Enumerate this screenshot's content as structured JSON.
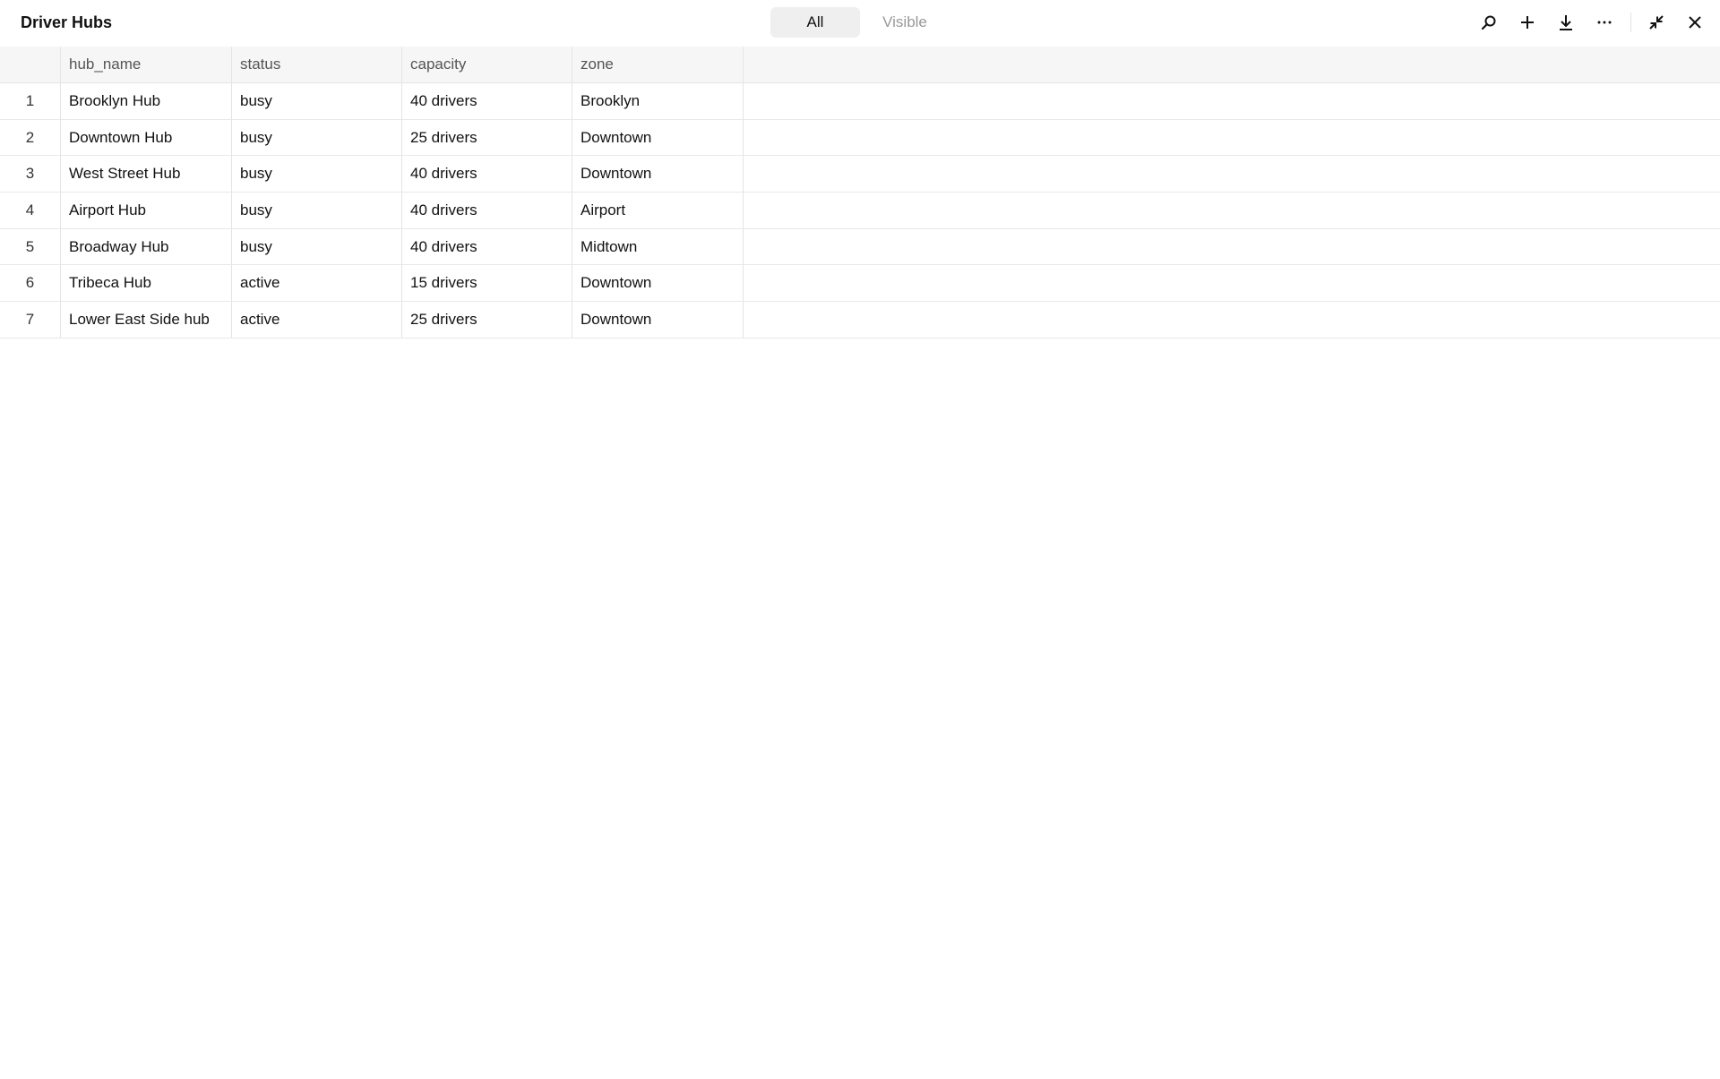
{
  "header": {
    "title": "Driver Hubs",
    "segments": {
      "all": "All",
      "visible": "Visible"
    },
    "tools": [
      "search-icon",
      "plus-icon",
      "download-icon",
      "more-icon",
      "collapse-icon",
      "close-icon"
    ]
  },
  "table": {
    "columns": [
      "hub_name",
      "status",
      "capacity",
      "zone"
    ],
    "rows": [
      {
        "index": "1",
        "hub_name": "Brooklyn Hub",
        "status": "busy",
        "capacity": "40 drivers",
        "zone": "Brooklyn"
      },
      {
        "index": "2",
        "hub_name": "Downtown Hub",
        "status": "busy",
        "capacity": "25 drivers",
        "zone": "Downtown"
      },
      {
        "index": "3",
        "hub_name": "West Street Hub",
        "status": "busy",
        "capacity": "40 drivers",
        "zone": "Downtown"
      },
      {
        "index": "4",
        "hub_name": "Airport Hub",
        "status": "busy",
        "capacity": "40 drivers",
        "zone": "Airport"
      },
      {
        "index": "5",
        "hub_name": "Broadway Hub",
        "status": "busy",
        "capacity": "40 drivers",
        "zone": "Midtown"
      },
      {
        "index": "6",
        "hub_name": "Tribeca Hub",
        "status": "active",
        "capacity": "15 drivers",
        "zone": "Downtown"
      },
      {
        "index": "7",
        "hub_name": "Lower East Side hub",
        "status": "active",
        "capacity": "25 drivers",
        "zone": "Downtown"
      }
    ]
  }
}
